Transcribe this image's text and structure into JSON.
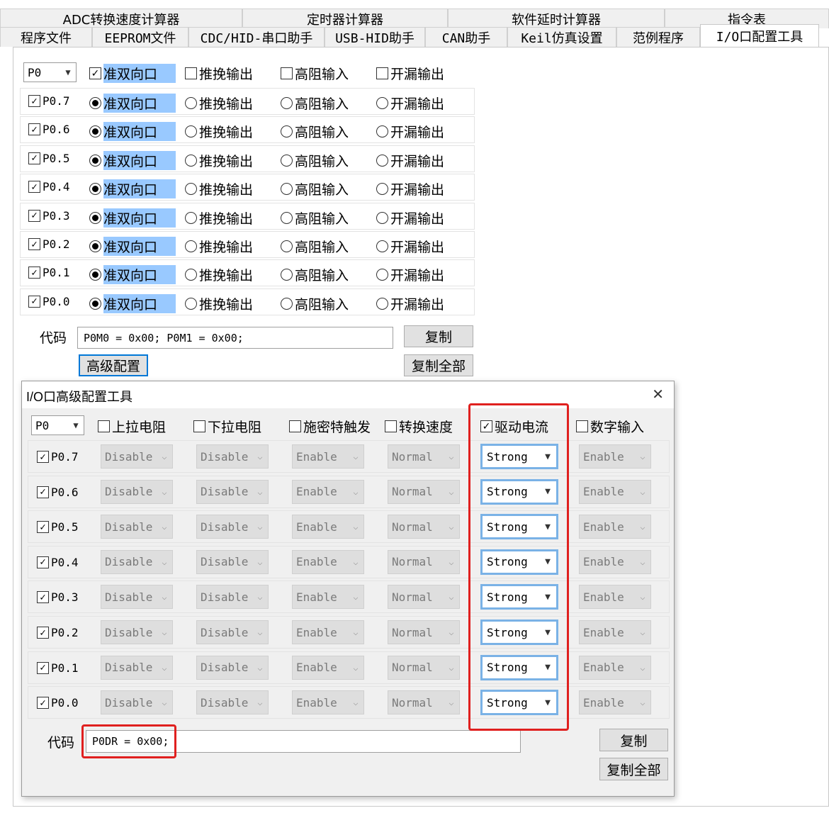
{
  "tabs": {
    "row1": [
      "ADC转换速度计算器",
      "定时器计算器",
      "软件延时计算器",
      "指令表"
    ],
    "row2": [
      "程序文件",
      "EEPROM文件",
      "CDC/HID-串口助手",
      "USB-HID助手",
      "CAN助手",
      "Keil仿真设置",
      "范例程序",
      "I/O口配置工具"
    ],
    "active": "I/O口配置工具"
  },
  "io_config": {
    "port_select": "P0",
    "header_options": [
      "准双向口",
      "推挽输出",
      "高阻输入",
      "开漏输出"
    ],
    "pins": [
      {
        "label": "P0.7",
        "mode": "准双向口"
      },
      {
        "label": "P0.6",
        "mode": "准双向口"
      },
      {
        "label": "P0.5",
        "mode": "准双向口"
      },
      {
        "label": "P0.4",
        "mode": "准双向口"
      },
      {
        "label": "P0.3",
        "mode": "准双向口"
      },
      {
        "label": "P0.2",
        "mode": "准双向口"
      },
      {
        "label": "P0.1",
        "mode": "准双向口"
      },
      {
        "label": "P0.0",
        "mode": "准双向口"
      }
    ],
    "code_label": "代码",
    "code_value": "P0M0 = 0x00; P0M1 = 0x00;",
    "copy_label": "复制",
    "copy_all_label": "复制全部",
    "advanced_label": "高级配置"
  },
  "advanced_dialog": {
    "title": "I/O口高级配置工具",
    "close_glyph": "✕",
    "port_select": "P0",
    "columns": [
      "上拉电阻",
      "下拉电阻",
      "施密特触发",
      "转换速度",
      "驱动电流",
      "数字输入"
    ],
    "column_checked": [
      false,
      false,
      false,
      false,
      true,
      false
    ],
    "pins": [
      {
        "label": "P0.7",
        "values": [
          "Disable",
          "Disable",
          "Enable",
          "Normal",
          "Strong",
          "Enable"
        ]
      },
      {
        "label": "P0.6",
        "values": [
          "Disable",
          "Disable",
          "Enable",
          "Normal",
          "Strong",
          "Enable"
        ]
      },
      {
        "label": "P0.5",
        "values": [
          "Disable",
          "Disable",
          "Enable",
          "Normal",
          "Strong",
          "Enable"
        ]
      },
      {
        "label": "P0.4",
        "values": [
          "Disable",
          "Disable",
          "Enable",
          "Normal",
          "Strong",
          "Enable"
        ]
      },
      {
        "label": "P0.3",
        "values": [
          "Disable",
          "Disable",
          "Enable",
          "Normal",
          "Strong",
          "Enable"
        ]
      },
      {
        "label": "P0.2",
        "values": [
          "Disable",
          "Disable",
          "Enable",
          "Normal",
          "Strong",
          "Enable"
        ]
      },
      {
        "label": "P0.1",
        "values": [
          "Disable",
          "Disable",
          "Enable",
          "Normal",
          "Strong",
          "Enable"
        ]
      },
      {
        "label": "P0.0",
        "values": [
          "Disable",
          "Disable",
          "Enable",
          "Normal",
          "Strong",
          "Enable"
        ]
      }
    ],
    "code_label": "代码",
    "code_value": "P0DR = 0x00;",
    "copy_label": "复制",
    "copy_all_label": "复制全部"
  },
  "colors": {
    "highlight": "#99c9ff",
    "annotation_red": "#e0201f",
    "focus_blue": "#7ab2e6"
  }
}
